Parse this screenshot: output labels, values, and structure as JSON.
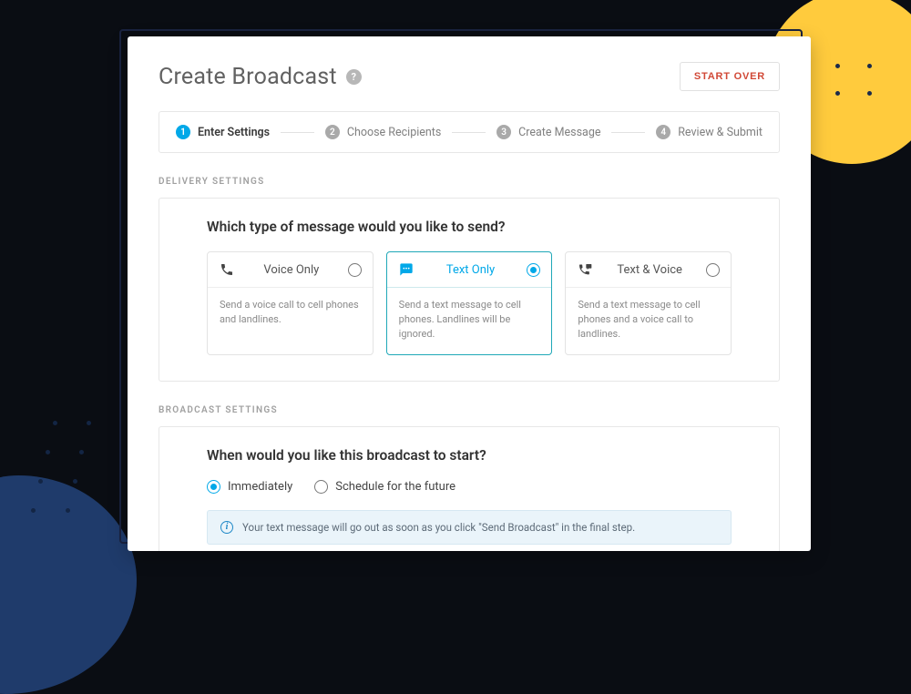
{
  "header": {
    "title": "Create Broadcast",
    "start_over_label": "START OVER"
  },
  "stepper": {
    "steps": [
      {
        "num": "1",
        "label": "Enter Settings",
        "active": true
      },
      {
        "num": "2",
        "label": "Choose Recipients",
        "active": false
      },
      {
        "num": "3",
        "label": "Create Message",
        "active": false
      },
      {
        "num": "4",
        "label": "Review & Submit",
        "active": false
      }
    ]
  },
  "delivery": {
    "section_label": "DELIVERY SETTINGS",
    "question": "Which type of message would you like to send?",
    "options": [
      {
        "id": "voice",
        "title": "Voice Only",
        "desc": "Send a voice call to cell phones and landlines.",
        "selected": false,
        "icon": "phone-icon"
      },
      {
        "id": "text",
        "title": "Text Only",
        "desc": "Send a text message to cell phones. Landlines will be ignored.",
        "selected": true,
        "icon": "chat-icon"
      },
      {
        "id": "both",
        "title": "Text & Voice",
        "desc": "Send a text message to cell phones and a voice call to landlines.",
        "selected": false,
        "icon": "phone-chat-icon"
      }
    ]
  },
  "broadcast": {
    "section_label": "BROADCAST SETTINGS",
    "question": "When would you like this broadcast to start?",
    "timing_options": [
      {
        "id": "immediately",
        "label": "Immediately",
        "selected": true
      },
      {
        "id": "schedule",
        "label": "Schedule for the future",
        "selected": false
      }
    ],
    "info_text": "Your text message will go out as soon as you click \"Send Broadcast\" in the final step."
  }
}
